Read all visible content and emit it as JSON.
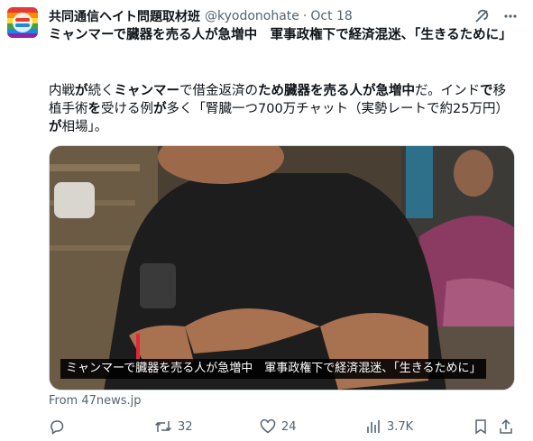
{
  "tweet": {
    "author_name": "共同通信ヘイト問題取材班",
    "handle": "@kyodonohate",
    "separator": "·",
    "date": "Oct 18",
    "headline": "ミャンマーで臓器を売る人が急増中　軍事政権下で経済混迷、「生きるために」",
    "body": {
      "part1": "内戦",
      "part2": "が",
      "part3": "続く",
      "part4": "ミャンマー",
      "part5": "で借金返済の",
      "part6": "ため臓器を売る人が急増中",
      "part7": "だ。インド",
      "part8": "で",
      "part9": "移植手術",
      "part10": "を",
      "part11": "受ける例",
      "part12": "が",
      "part13": "多く「腎臓一つ700万チャット（実勢レートで約25万円）",
      "part14": "が",
      "part15": "相場」。"
    },
    "media_caption": "ミャンマーで臓器を売る人が急増中　軍事政権下で経済混迷、「生きるために」",
    "source": "From 47news.jp",
    "actions": {
      "reply_count": "",
      "retweet_count": "32",
      "like_count": "24",
      "views_count": "3.7K"
    }
  },
  "colors": {
    "text": "#0f1419",
    "secondary": "#536471",
    "border": "#cfd9de"
  },
  "icons": [
    "grok-icon",
    "more-icon",
    "reply-icon",
    "retweet-icon",
    "like-icon",
    "views-icon",
    "bookmark-icon",
    "share-icon"
  ]
}
